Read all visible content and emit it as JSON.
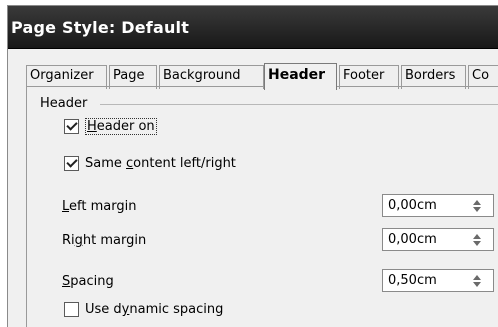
{
  "window": {
    "title": "Page Style: Default"
  },
  "tabs": [
    {
      "label": "Organizer",
      "active": false
    },
    {
      "label": "Page",
      "active": false
    },
    {
      "label": "Background",
      "active": false
    },
    {
      "label": "Header",
      "active": true
    },
    {
      "label": "Footer",
      "active": false
    },
    {
      "label": "Borders",
      "active": false
    },
    {
      "label": "Co",
      "active": false
    }
  ],
  "header_section": {
    "group_label": "Header",
    "header_on": {
      "mn": "H",
      "rest": "eader on",
      "checked": true
    },
    "same_content": {
      "pre": "Same ",
      "mn": "c",
      "rest": "ontent left/right",
      "checked": true
    },
    "left_margin": {
      "mn": "L",
      "rest": "eft margin",
      "value": "0,00cm"
    },
    "right_margin": {
      "pre": "Ri",
      "mn": "g",
      "rest": "ht margin",
      "value": "0,00cm"
    },
    "spacing": {
      "mn": "S",
      "rest": "pacing",
      "value": "0,50cm"
    },
    "dynamic_spacing": {
      "pre": "Use d",
      "mn": "y",
      "rest": "namic spacing",
      "checked": false
    }
  }
}
